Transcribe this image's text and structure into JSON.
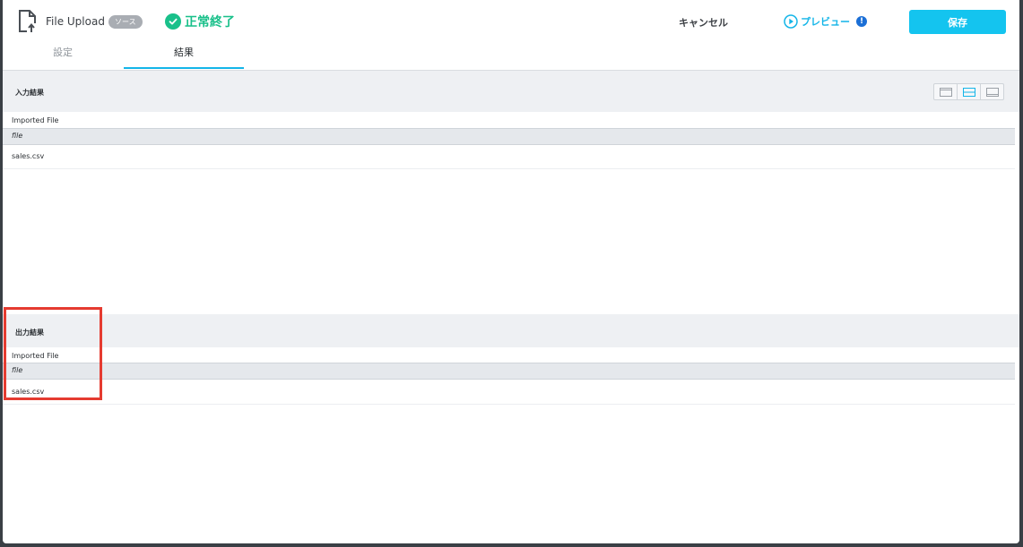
{
  "header": {
    "title": "File Upload",
    "badge": "ソース",
    "status": "正常終了",
    "cancel_label": "キャンセル",
    "preview_label": "プレビュー",
    "alert_glyph": "!",
    "save_label": "保存"
  },
  "tabs": [
    {
      "label": "設定",
      "active": false
    },
    {
      "label": "結果",
      "active": true
    }
  ],
  "input_section": {
    "title": "入力結果",
    "table_caption": "Imported File",
    "column": "file",
    "rows": [
      "sales.csv"
    ]
  },
  "output_section": {
    "title": "出力結果",
    "table_caption": "Imported File",
    "column": "file",
    "rows": [
      "sales.csv"
    ]
  },
  "colors": {
    "accent": "#13b5e8",
    "success": "#19c08a",
    "save_button": "#14c4ef",
    "highlight": "#e53b30"
  }
}
